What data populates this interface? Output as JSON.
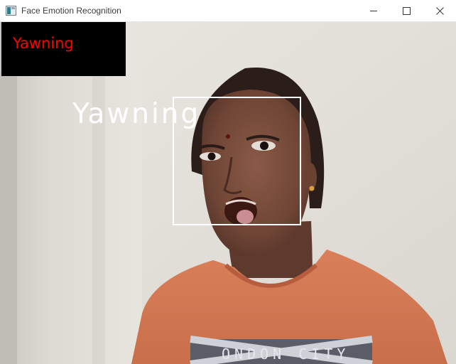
{
  "window": {
    "title": "Face Emotion Recognition",
    "app_icon": "opencv-window-icon",
    "controls": {
      "minimize_icon": "minimize-icon",
      "maximize_icon": "maximize-icon",
      "close_icon": "close-icon"
    }
  },
  "frame": {
    "prediction_badge": {
      "label": "Yawning",
      "text_color": "#ff0000",
      "background": "#000000"
    },
    "face_overlay": {
      "label": "Yawning",
      "color": "#ffffff"
    },
    "shirt_print": "ONDON CITY"
  }
}
